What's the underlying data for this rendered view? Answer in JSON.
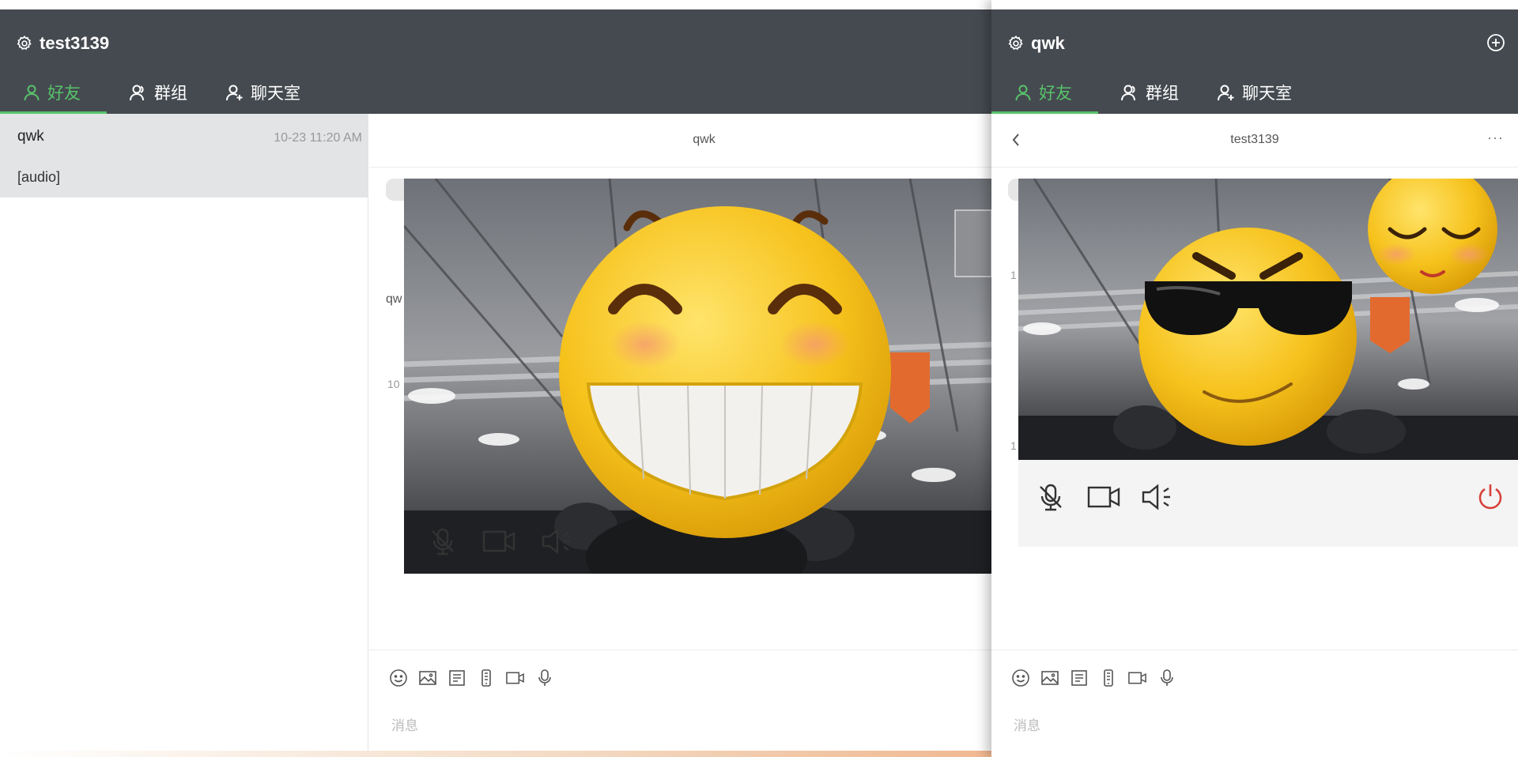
{
  "left": {
    "username": "test3139",
    "tabs": [
      {
        "label": "好友",
        "active": true
      },
      {
        "label": "群组",
        "active": false
      },
      {
        "label": "聊天室",
        "active": false
      }
    ],
    "conversation": {
      "name": "qwk",
      "time": "10-23 11:20 AM",
      "preview": "[audio]"
    },
    "chat_title": "qwk",
    "partial_texts": {
      "sender": "qw",
      "time1": "10"
    },
    "composer_placeholder": "消息"
  },
  "right": {
    "username": "qwk",
    "tabs": [
      {
        "label": "好友",
        "active": true
      },
      {
        "label": "群组",
        "active": false
      },
      {
        "label": "聊天室",
        "active": false
      }
    ],
    "chat_title": "test3139",
    "more_label": "···",
    "partial_texts": {
      "a": "1",
      "b": "1"
    },
    "composer_placeholder": "消息"
  },
  "colors": {
    "header_bg": "#454a50",
    "accent_green": "#57c26a",
    "end_call_red": "#d9413a"
  },
  "icons": [
    "gear-icon",
    "user-icon",
    "group-icon",
    "chatroom-icon",
    "plus-circle-icon",
    "back-icon",
    "mic-off-icon",
    "camera-icon",
    "speaker-icon",
    "power-icon",
    "emoji-icon",
    "image-icon",
    "file-icon",
    "phone-icon",
    "video-icon",
    "mic-icon"
  ]
}
